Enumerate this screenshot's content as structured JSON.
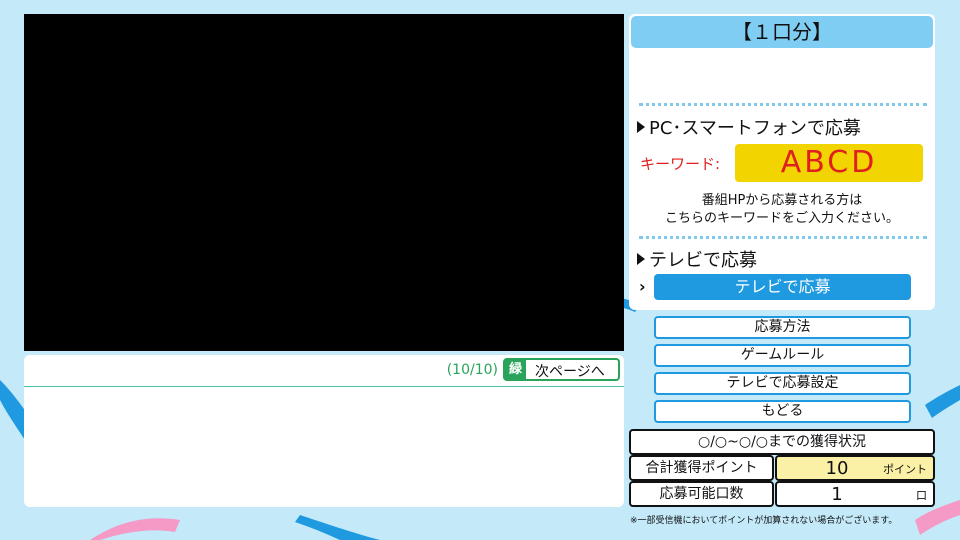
{
  "colors": {
    "background": "#c4eafa",
    "accent_blue": "#1f9ae0",
    "title_blue": "#7fcdf3",
    "keyword_yellow": "#f2d500",
    "keyword_red": "#e02020",
    "green_key": "#2aa45a",
    "points_yellow": "#fbf1a6"
  },
  "textbox": {
    "page_indicator": "(10/10)",
    "green_key": "緑",
    "next_label": "次ページへ"
  },
  "panel": {
    "title": "【１口分】",
    "pc_heading": "PC･スマートフォンで応募",
    "keyword_label": "キーワード:",
    "keyword_value": "ABCD",
    "note_line1": "番組HPから応募される方は",
    "note_line2": "こちらのキーワードをご入力ください。",
    "tv_heading": "テレビで応募",
    "tv_arrow": "›",
    "tv_button": "テレビで応募"
  },
  "menu": [
    {
      "label": "応募方法"
    },
    {
      "label": "ゲームルール"
    },
    {
      "label": "テレビで応募設定"
    },
    {
      "label": "もどる"
    }
  ],
  "stats": {
    "heading": "○/○~○/○までの獲得状況",
    "points_label": "合計獲得ポイント",
    "points_value": "10",
    "points_unit": "ポイント",
    "entries_label": "応募可能口数",
    "entries_value": "1",
    "entries_unit": "口"
  },
  "footnote": "※一部受信機においてポイントが加算されない場合がございます。"
}
